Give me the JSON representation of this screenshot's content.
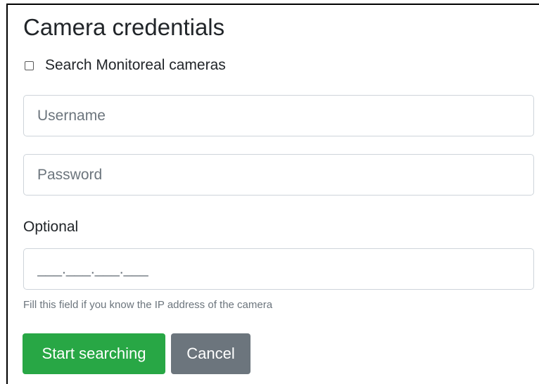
{
  "dialog": {
    "title": "Camera credentials",
    "search_checkbox": {
      "label": "Search Monitoreal cameras",
      "checked": false
    },
    "username": {
      "placeholder": "Username",
      "value": ""
    },
    "password": {
      "placeholder": "Password",
      "value": ""
    },
    "optional_label": "Optional",
    "ip": {
      "placeholder": "___.___.___.___",
      "value": "",
      "help": "Fill this field if you know the IP address of the camera"
    },
    "buttons": {
      "start": "Start searching",
      "cancel": "Cancel"
    }
  },
  "colors": {
    "primary_action": "#28a745",
    "secondary_action": "#6c757d",
    "input_border": "#ced4da",
    "help_text": "#6c757d"
  }
}
